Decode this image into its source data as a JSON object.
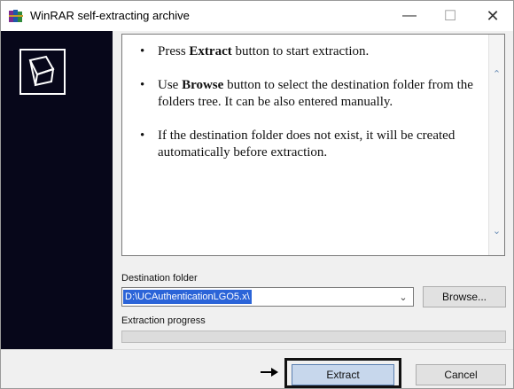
{
  "window": {
    "title": "WinRAR self-extracting archive",
    "icon": "winrar-books-icon",
    "controls": {
      "minimize": "—",
      "maximize": "☐",
      "close": "✕"
    }
  },
  "sidebar": {
    "logo": "box-logo-icon",
    "background": "#07071a"
  },
  "info": {
    "items": [
      [
        "Press ",
        "Extract",
        " button to start extraction."
      ],
      [
        "Use ",
        "Browse",
        " button to select the destination folder from the folders tree. It can be also entered manually."
      ],
      [
        "If the destination folder does not exist, it will be created automatically before extraction."
      ]
    ]
  },
  "destination": {
    "label": "Destination folder",
    "value": "D:\\UCAuthenticationLGO5.x\\",
    "browse_label": "Browse..."
  },
  "progress": {
    "label": "Extraction progress",
    "percent": 0
  },
  "buttons": {
    "extract_label": "Extract",
    "cancel_label": "Cancel"
  },
  "colors": {
    "accent": "#2b64d8",
    "selection_text": "#ffffff"
  }
}
